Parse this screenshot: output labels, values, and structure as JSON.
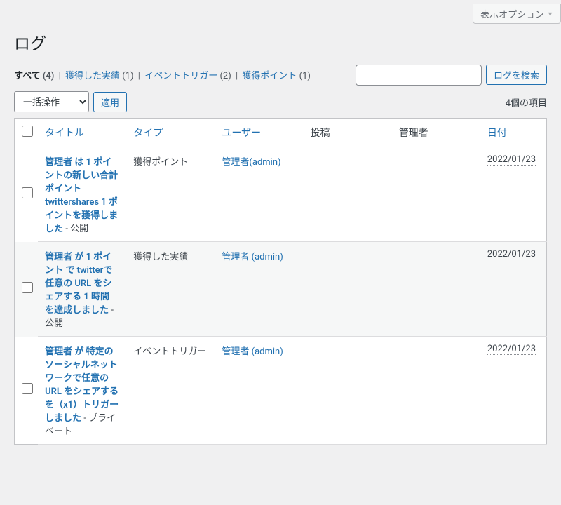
{
  "topbar": {
    "screen_options": "表示オプション"
  },
  "page": {
    "title": "ログ"
  },
  "filters": {
    "all_label": "すべて",
    "all_count": "(4)",
    "achievement_label": "獲得した実績",
    "achievement_count": "(1)",
    "event_label": "イベントトリガー",
    "event_count": "(2)",
    "points_label": "獲得ポイント",
    "points_count": "(1)"
  },
  "search": {
    "button": "ログを検索"
  },
  "bulk": {
    "select": "一括操作",
    "apply": "適用"
  },
  "count_text": "4個の項目",
  "columns": {
    "title": "タイトル",
    "type": "タイプ",
    "user": "ユーザー",
    "post": "投稿",
    "admin": "管理者",
    "date": "日付"
  },
  "rows": [
    {
      "title": "管理者 は 1 ポイントの新しい合計ポイント twittershares 1 ポイントを獲得しました",
      "state": " - 公開",
      "type": "獲得ポイント",
      "user": "管理者",
      "user_sub": "(admin)",
      "date": "2022/01/23"
    },
    {
      "title": "管理者 が 1 ポイント で twitterで任意の URL をシェアする 1 時間 を達成しました",
      "state": " - 公開",
      "type": "獲得した実績",
      "user": "管理者",
      "user_sub": " (admin)",
      "date": "2022/01/23"
    },
    {
      "title": "管理者 が 特定のソーシャルネットワークで任意の URL をシェアする を（x1）トリガーしました",
      "state": " - プライベート",
      "type": "イベントトリガー",
      "user": "管理者",
      "user_sub": " (admin)",
      "date": "2022/01/23"
    }
  ]
}
